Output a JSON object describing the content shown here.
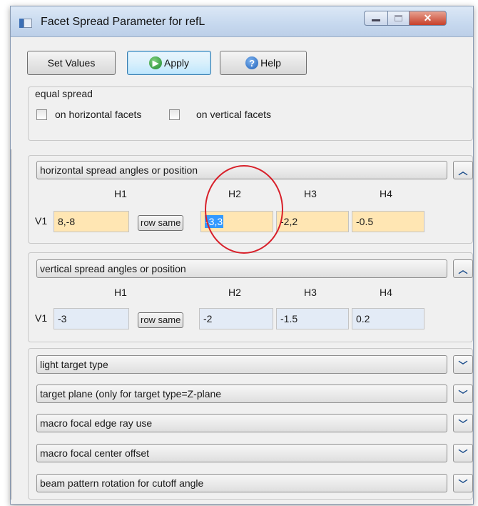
{
  "window": {
    "title": "Facet Spread Parameter for refL"
  },
  "toolbar": {
    "set_values_label": "Set Values",
    "apply_label": "Apply",
    "help_label": "Help"
  },
  "equal_spread": {
    "label": "equal spread",
    "horizontal_label": "on horizontal facets",
    "vertical_label": "on vertical facets",
    "horizontal_checked": false,
    "vertical_checked": false
  },
  "horizontal_section": {
    "header": "horizontal spread angles or position",
    "columns": [
      "H1",
      "H2",
      "H3",
      "H4"
    ],
    "row_label": "V1",
    "row_same_label": "row same",
    "values": [
      "8,-8",
      "-3,3",
      "-2,2",
      "-0.5"
    ],
    "field_color": "#ffe6b3"
  },
  "vertical_section": {
    "header": "vertical spread angles or position",
    "columns": [
      "H1",
      "H2",
      "H3",
      "H4"
    ],
    "row_label": "V1",
    "row_same_label": "row same",
    "values": [
      "-3",
      "-2",
      "-1.5",
      "0.2"
    ],
    "field_color": "#e3ebf6"
  },
  "collapsed_sections": [
    "light target type",
    "target plane (only for target type=Z-plane",
    "macro focal edge ray use",
    "macro focal center offset",
    "beam pattern rotation for cutoff angle"
  ],
  "icons": {
    "expanded_toggle": "chevron-up-icon",
    "collapsed_toggle": "chevron-down-icon",
    "apply": "green-arrow-icon",
    "help": "question-mark-icon"
  },
  "annotation_color": "#d8202a"
}
